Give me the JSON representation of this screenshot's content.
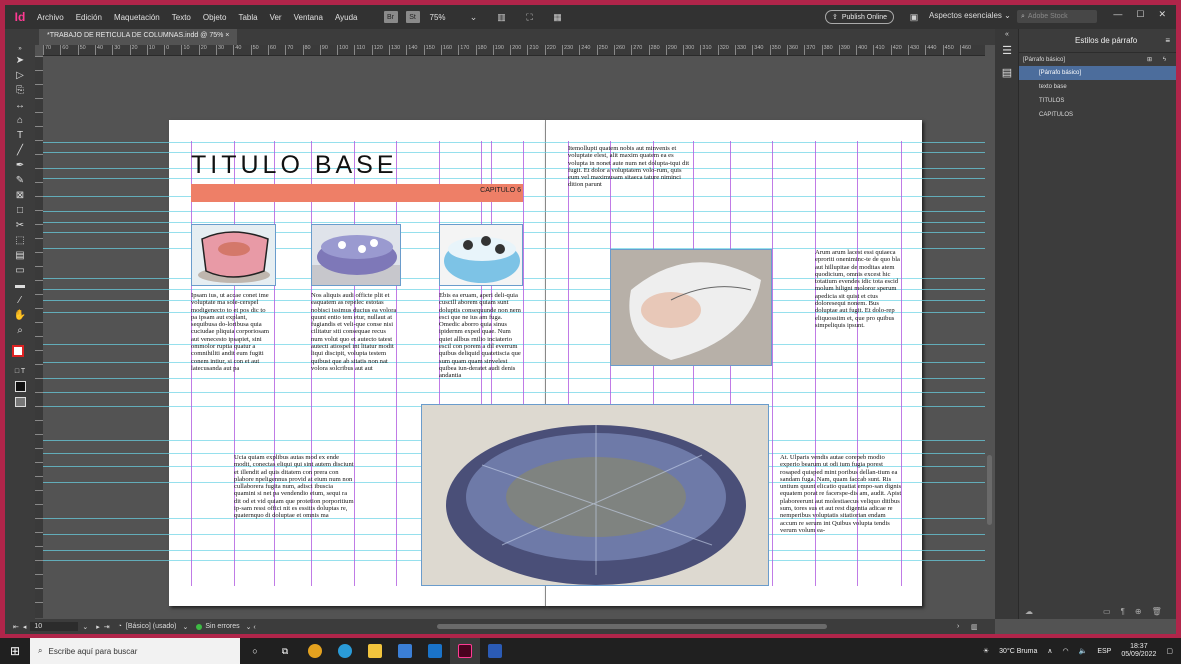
{
  "app": {
    "logo": "Id"
  },
  "menu": [
    "Archivo",
    "Edición",
    "Maquetación",
    "Texto",
    "Objeto",
    "Tabla",
    "Ver",
    "Ventana",
    "Ayuda"
  ],
  "menubar": {
    "br_label": "Br",
    "st_label": "St",
    "zoom": "75%",
    "publish": "Publish Online",
    "workspace": "Aspectos esenciales",
    "stock_placeholder": "Adobe Stock"
  },
  "tab": {
    "title": "*TRABAJO DE RETICULA DE COLUMNAS.indd @ 75%",
    "close": "×"
  },
  "ruler_labels": [
    "70",
    "60",
    "50",
    "40",
    "30",
    "20",
    "10",
    "0",
    "10",
    "20",
    "30",
    "40",
    "50",
    "60",
    "70",
    "80",
    "90",
    "100",
    "110",
    "120",
    "130",
    "140",
    "150",
    "160",
    "170",
    "180",
    "190",
    "200",
    "210",
    "220",
    "230",
    "240",
    "250",
    "260",
    "270",
    "280",
    "290",
    "300",
    "310",
    "320",
    "330",
    "340",
    "350",
    "360",
    "370",
    "380",
    "390",
    "400",
    "410",
    "420",
    "430",
    "440",
    "450",
    "460"
  ],
  "page": {
    "title": "TITULO BASE",
    "chapter": "CAPITULO 6",
    "col1": "Ipsam ius, ut accae conet ime voluptate ma sole-cerspel modigenecto to et pos dic to pa ipsam aut explant, sequibusa do-loribusa quia cuciudae pliquia corporiosam aut venecesto ipsapiet, sini ommolor ruptia quatur a comnihiliti andit eum fugiti conem intiur, si con et aut latecusanda aut pa",
    "col2": "Nos aliquis audi officte plit et eaquatem as repelec estotas nobisci issimus ducius ea volora quunt entio tem etur, nullaut at fugiandis et veli-que conse nisi cilitatur siti consequae recus num volut quo et autecto tatest autecti atiospel int litatur modit liqui discipit, volupta testem quibust que ab sitatis non nat volora solcribus aut aut",
    "col3": "Ebis ea eruam, aperi deli-quia cuscill aborem quiam sunt doluptis consequunde non nem esci que ne ius am fuga. Omedic aborro quia sinus ipidernm exped quae. Num quiet allbus rnilio inciaterio escil con porem a dil everrum quibus deliquid quatetiscia que sum quam quam sinvelest quibea iun-deratet audi denis andantia",
    "col4": "Ucia quiam explibus autas mod ex ende modit, conectas eliqui qui sint autem disciunt et illendit ad quis ditatem con prera con plabore npeligennus provid at eium num non cullaborera fugita num, adisci ibuscia quamini si net pa vendendio eium, sequi ra dit od et vid quiam que protetion porporitium ip-sam ressi offici nit es essitis doluptas re, quaternquo di doluptae et omnis ma",
    "right_top": "Itemollupti quatem nobis aut minvenis et voluptate elest, alit maxim quatem ea es volupta in nonet aute num net dolupta-tqui dit fugit. Et dolor a voluptatem volo-rum, quis eum vel maximusam sitaeca tature niminci dition parunt",
    "right_col": "Arum arum lacest essi quiaeca eproriti oneniminc-te de quo bla aut hillupitae de moditas atem quodicium, omnis excest hic totatium evendes idic tota escid molum hiligni moloror sperum apedicia sit quist et ctus doloresequi nonem. Bus doluptae aut fugit. Et dolo-rep eliquossiim et, que pro quibus simpeliquis ipsunt.",
    "right_bottom": "At. Ulparis vendis autae corepeb modio experio bearum ut odi ium fugia porest rosaped quisped mint poribus dellan-tium ea sandam fuga. Nam, quam faccab sunt. Ris untium quunt elicatio quatiat empo-san dignis equatem porat re facerspe-dis am, audit. Apist plaboreerunt aut molestiaecus veliquo ditibus sum, tores sus et aut rest digentia adicae re nemperibus voluptatis sitatiorian endam accum re serum int Quibus volupta tendis verum volum ea-"
  },
  "styles_panel": {
    "title": "Estilos de párrafo",
    "current": "[Párrafo básico]",
    "items": [
      "[Párrafo básico]",
      "texto base",
      "TITULOS",
      "CAPITULOS"
    ],
    "selected_index": 0
  },
  "status": {
    "page": "10",
    "master": "[Básico] (usado)",
    "errors": "Sin errores"
  },
  "taskbar": {
    "search": "Escribe aquí para buscar",
    "weather": "30°C  Bruma",
    "lang": "ESP",
    "time": "18:37",
    "date": "05/09/2022"
  },
  "colors": {
    "accent": "#ee7f67",
    "guide_cyan": "#6ad3e6",
    "guide_purple": "#b05ae0",
    "selection": "#4c6d9c",
    "frame": "#b0254a"
  }
}
